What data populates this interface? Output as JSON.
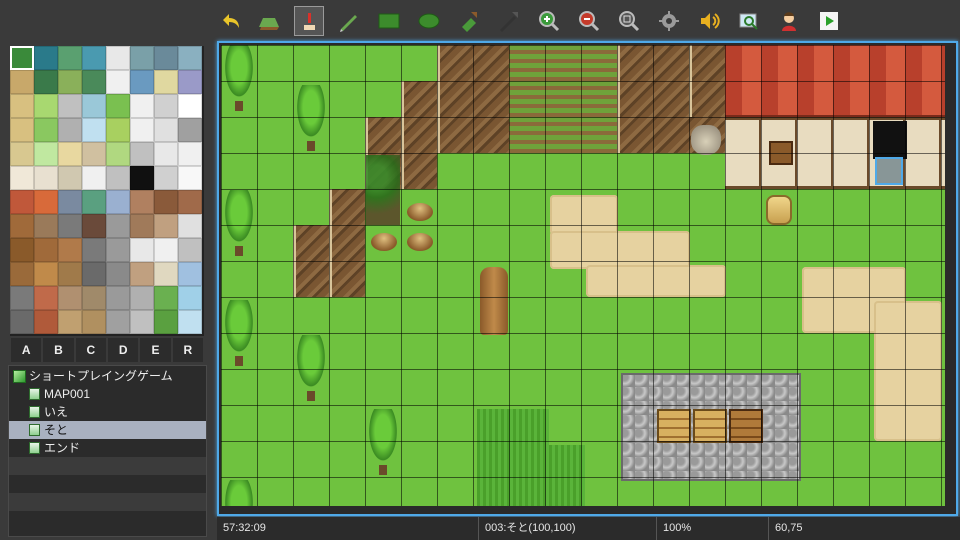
{
  "toolbar": {
    "buttons": [
      {
        "name": "undo",
        "icon": "undo-arrow-icon"
      },
      {
        "name": "map-layer",
        "icon": "map-layer-icon"
      },
      {
        "name": "event-layer",
        "icon": "event-layer-icon",
        "active": true
      },
      {
        "name": "pencil",
        "icon": "pencil-icon"
      },
      {
        "name": "rectangle",
        "icon": "rectangle-icon"
      },
      {
        "name": "ellipse",
        "icon": "ellipse-icon"
      },
      {
        "name": "flood-fill",
        "icon": "fill-bucket-icon"
      },
      {
        "name": "shadow-pen",
        "icon": "shadow-pen-icon"
      },
      {
        "name": "zoom-in",
        "icon": "zoom-in-icon"
      },
      {
        "name": "zoom-out",
        "icon": "zoom-out-icon"
      },
      {
        "name": "actual-size",
        "icon": "actual-size-icon"
      },
      {
        "name": "database",
        "icon": "gear-icon"
      },
      {
        "name": "sound-test",
        "icon": "speaker-icon"
      },
      {
        "name": "event-search",
        "icon": "event-search-icon"
      },
      {
        "name": "character-generator",
        "icon": "character-icon"
      },
      {
        "name": "playtest",
        "icon": "play-icon"
      }
    ]
  },
  "palette": {
    "tabs": [
      "A",
      "B",
      "C",
      "D",
      "E",
      "R"
    ]
  },
  "maptree": {
    "project": "ショートプレイングゲーム",
    "maps": [
      {
        "label": "MAP001"
      },
      {
        "label": "いえ"
      },
      {
        "label": "そと",
        "selected": true
      },
      {
        "label": "エンド"
      }
    ]
  },
  "status": {
    "time": "57:32:09",
    "map_info": "003:そと(100,100)",
    "zoom": "100%",
    "coords": "60,75"
  },
  "colors": {
    "accent": "#4fa9e8",
    "grass": "#6fc23f",
    "dirt": "#e6d2a0",
    "roof": "#c64a35",
    "cliff": "#7a5632"
  }
}
